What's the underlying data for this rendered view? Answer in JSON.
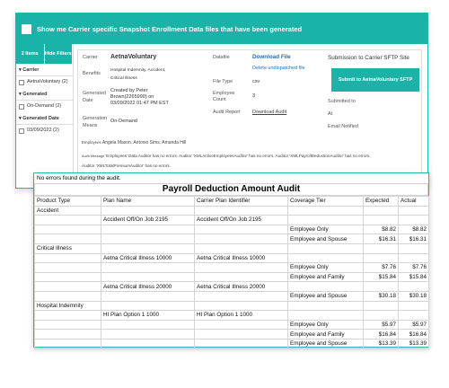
{
  "header": {
    "title": "Show me Carrier specific Snapshot Enrollment Data files that have been generated"
  },
  "sidebar": {
    "items_count": "2 Items",
    "hide_filters": "Hide Filters",
    "groups": [
      {
        "label": "Carrier",
        "options": [
          {
            "label": "AetnaVoluntary (2)"
          }
        ]
      },
      {
        "label": "Generated",
        "options": [
          {
            "label": "On-Demand (2)"
          }
        ]
      },
      {
        "label": "Generated Date",
        "options": [
          {
            "label": "03/09/2022 (2)"
          }
        ]
      }
    ]
  },
  "detail": {
    "carrier_label": "Carrier",
    "carrier_value": "AetnaVoluntary",
    "benefits_label": "Benefits",
    "benefits_value": "Hospital Indemnity, Accident, Critical Illness",
    "generated_date_label": "Generated Date",
    "generated_date_value": "Created by Peter Brown(2265990) on 03/09/2022 01:47 PM EST",
    "generation_means_label": "Generation Means",
    "generation_means_value": "On-Demand",
    "datafile_label": "Datafile",
    "download_file": "Download File",
    "delete_file": "Delete undispatched file",
    "file_type_label": "File Type",
    "file_type_value": "csv",
    "employee_count_label": "Employee Count",
    "employee_count_value": "3",
    "audit_report_label": "Audit Report",
    "download_audit": "Download Audit",
    "submission_title": "Submission to Carrier SFTP Site",
    "submit_button": "Submit to AetnaVoluntary SFTP",
    "submitted_to": "Submitted to",
    "at": "At",
    "email_notified": "Email Notified",
    "employees_label": "Employees",
    "employees_value": "Angela Mason, Antonio Sims, Amanda Hill",
    "audit_message_label": "Audit Message",
    "audit_message_1": "'Employees' Data Auditor has no errors. Auditor 'XMLActiveEmployeesAuditor' has no errors. Auditor 'XMLPayrollDeductionAuditor' has no errors.",
    "audit_message_2": "Auditor 'XMLTotalPremiumAuditor' has no errors."
  },
  "audit": {
    "message": "No errors found during the audit.",
    "title": "Payroll Deduction Amount Audit",
    "columns": [
      "Product Type",
      "Plan Name",
      "Carrier Plan Identifier",
      "Coverage Tier",
      "Expected",
      "Actual"
    ],
    "rows": [
      [
        "Accident",
        "",
        "",
        "",
        "",
        ""
      ],
      [
        "",
        "Accident Off/On Job 2195",
        "Accident Off/On Job 2195",
        "",
        "",
        ""
      ],
      [
        "",
        "",
        "",
        "Employee Only",
        "$8.82",
        "$8.82"
      ],
      [
        "",
        "",
        "",
        "Employee and Spouse",
        "$16.31",
        "$16.31"
      ],
      [
        "Critical Illness",
        "",
        "",
        "",
        "",
        ""
      ],
      [
        "",
        "Aetna Critical Illness 10000",
        "Aetna Critical Illness 10000",
        "",
        "",
        ""
      ],
      [
        "",
        "",
        "",
        "Employee Only",
        "$7.76",
        "$7.76"
      ],
      [
        "",
        "",
        "",
        "Employee and Family",
        "$15.84",
        "$15.84"
      ],
      [
        "",
        "Aetna Critical Illness 20000",
        "Aetna Critical Illness 20000",
        "",
        "",
        ""
      ],
      [
        "",
        "",
        "",
        "Employee and Spouse",
        "$30.18",
        "$30.18"
      ],
      [
        "Hospital Indemnity",
        "",
        "",
        "",
        "",
        ""
      ],
      [
        "",
        "HI Plan Option 1 1000",
        "HI Plan Option 1 1000",
        "",
        "",
        ""
      ],
      [
        "",
        "",
        "",
        "Employee Only",
        "$5.97",
        "$5.97"
      ],
      [
        "",
        "",
        "",
        "Employee and Family",
        "$16.84",
        "$16.84"
      ],
      [
        "",
        "",
        "",
        "Employee and Spouse",
        "$13.39",
        "$13.39"
      ]
    ]
  },
  "colors": {
    "accent": "#1bb3a7",
    "link": "#1f6fb5"
  }
}
